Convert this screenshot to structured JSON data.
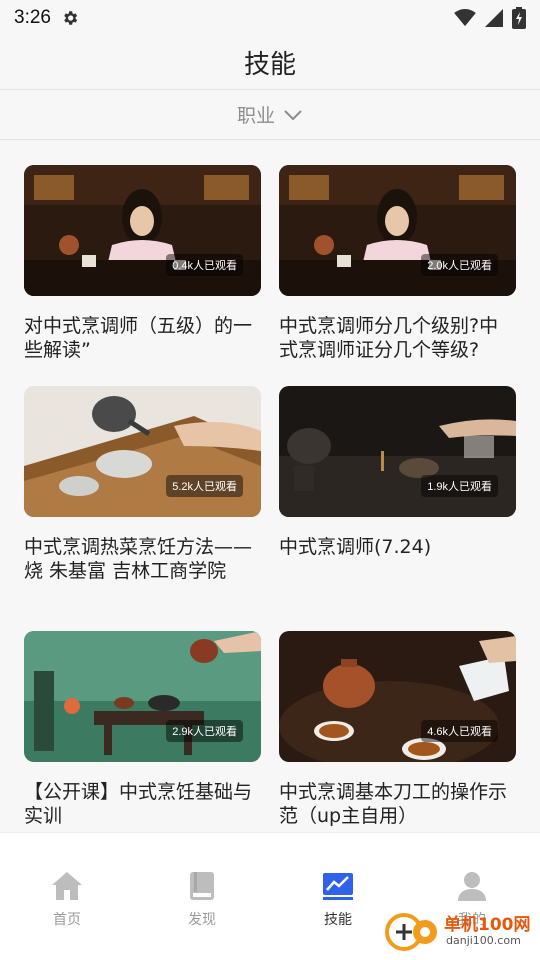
{
  "status_bar": {
    "time": "3:26"
  },
  "header": {
    "title": "技能"
  },
  "filter": {
    "label": "职业"
  },
  "cards": [
    {
      "title": "对中式烹调师（五级）的一些解读”",
      "views": "0.4k人已观看"
    },
    {
      "title": "中式烹调师分几个级别?中式烹调师证分几个等级?",
      "views": "2.0k人已观看"
    },
    {
      "title": "中式烹调热菜烹饪方法——烧 朱基富 吉林工商学院",
      "views": "5.2k人已观看"
    },
    {
      "title": "中式烹调师(7.24)",
      "views": "1.9k人已观看"
    },
    {
      "title": "【公开课】中式烹饪基础与实训",
      "views": "2.9k人已观看"
    },
    {
      "title": "中式烹调基本刀工的操作示范（up主自用）",
      "views": "4.6k人已观看"
    }
  ],
  "nav": [
    {
      "label": "首页"
    },
    {
      "label": "发现"
    },
    {
      "label": "技能"
    },
    {
      "label": "我的"
    }
  ],
  "watermark": {
    "brand": "单机100网",
    "url": "danji100.com"
  },
  "colors": {
    "accent": "#2f62e8",
    "nav_inactive": "#bdbdbd"
  }
}
